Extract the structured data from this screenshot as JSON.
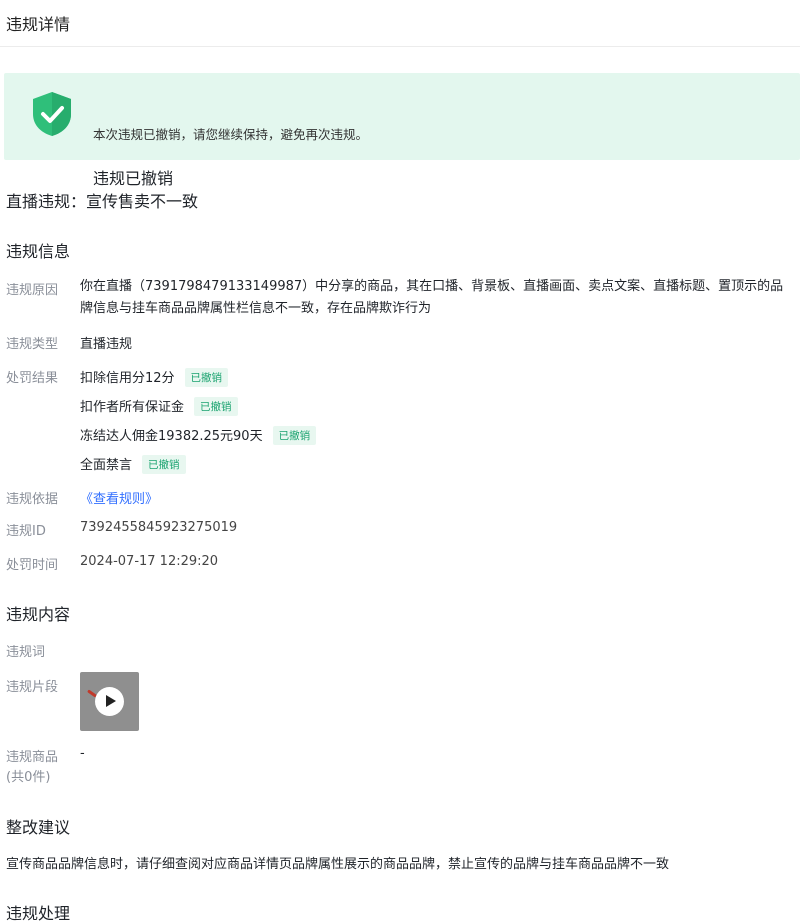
{
  "header": {
    "title": "违规详情"
  },
  "banner": {
    "title": "违规已撤销",
    "desc": "本次违规已撤销，请您继续保持，避免再次违规。",
    "accent_color": "#2fbf7a",
    "background_color": "#e3f7ee"
  },
  "violation_headline": "直播违规：宣传售卖不一致",
  "info_section": {
    "heading": "违规信息",
    "reason_label": "违规原因",
    "reason_text": "你在直播（7391798479133149987）中分享的商品，其在口播、背景板、直播画面、卖点文案、直播标题、置顶示的品牌信息与挂车商品品牌属性栏信息不一致，存在品牌欺诈行为",
    "type_label": "违规类型",
    "type_value": "直播违规",
    "penalty_label": "处罚结果",
    "penalties": [
      {
        "text": "扣除信用分12分",
        "tag": "已撤销"
      },
      {
        "text": "扣作者所有保证金",
        "tag": "已撤销"
      },
      {
        "text": "冻结达人佣金19382.25元90天",
        "tag": "已撤销"
      },
      {
        "text": "全面禁言",
        "tag": "已撤销"
      }
    ],
    "basis_label": "违规依据",
    "basis_link": "《查看规则》",
    "id_label": "违规ID",
    "id_value": "7392455845923275019",
    "time_label": "处罚时间",
    "time_value": "2024-07-17 12:29:20"
  },
  "content_section": {
    "heading": "违规内容",
    "word_label": "违规词",
    "clip_label": "违规片段",
    "clip_icon": "play-icon",
    "goods_label": "违规商品",
    "goods_count": "(共0件)",
    "goods_value": "-"
  },
  "advice_section": {
    "heading": "整改建议",
    "text": "宣传商品品牌信息时，请仔细查阅对应商品详情页品牌属性展示的商品品牌，禁止宣传的品牌与挂车商品品牌不一致"
  },
  "handling_section": {
    "heading": "违规处理"
  }
}
